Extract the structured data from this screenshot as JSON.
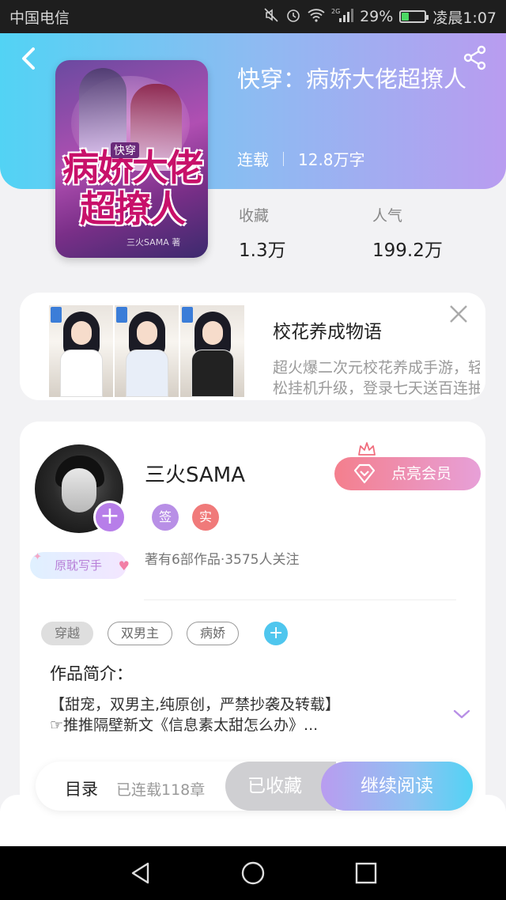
{
  "status_bar": {
    "carrier": "中国电信",
    "signal_label": "2G",
    "battery_percent": "29%",
    "battery_level": 0.29,
    "time": "凌晨1:07"
  },
  "header": {
    "back_icon": "chevron-left-icon",
    "share_icon": "share-icon",
    "accent_gradient": [
      "#52d3f4",
      "#b99cf0"
    ]
  },
  "book": {
    "cover_subtitle": "快穿",
    "cover_title": "病娇大佬超撩人",
    "cover_author": "三火SAMA 著",
    "title": "快穿：病娇大佬超撩人",
    "status": "连载",
    "word_count": "12.8万字",
    "stats": [
      {
        "label": "收藏",
        "value": "1.3万"
      },
      {
        "label": "人气",
        "value": "199.2万"
      }
    ]
  },
  "ad": {
    "title": "校花养成物语",
    "description_lines": [
      "超火爆二次元校花养成手游，轻",
      "松挂机升级，登录七天送百连抽"
    ],
    "close_icon": "close-icon"
  },
  "author": {
    "name": "三火SAMA",
    "tag": "原耽写手",
    "badges": [
      "签",
      "实"
    ],
    "works_info": "著有6部作品·3575人关注",
    "vip_button": "点亮会员",
    "follow_icon": "plus-icon"
  },
  "tags": [
    "穿越",
    "双男主",
    "病娇"
  ],
  "intro": {
    "label": "作品简介：",
    "line1": "【甜宠，双男主,纯原创，严禁抄袭及转载】",
    "line2": "☞推推隔壁新文《信息素太甜怎么办》..."
  },
  "bottom_bar": {
    "toc_label": "目录",
    "chapter_count": "已连载118章",
    "collected_label": "已收藏",
    "read_label": "继续阅读"
  },
  "nav_bar": {
    "back_icon": "triangle-back-icon",
    "home_icon": "circle-home-icon",
    "recent_icon": "square-recent-icon"
  }
}
